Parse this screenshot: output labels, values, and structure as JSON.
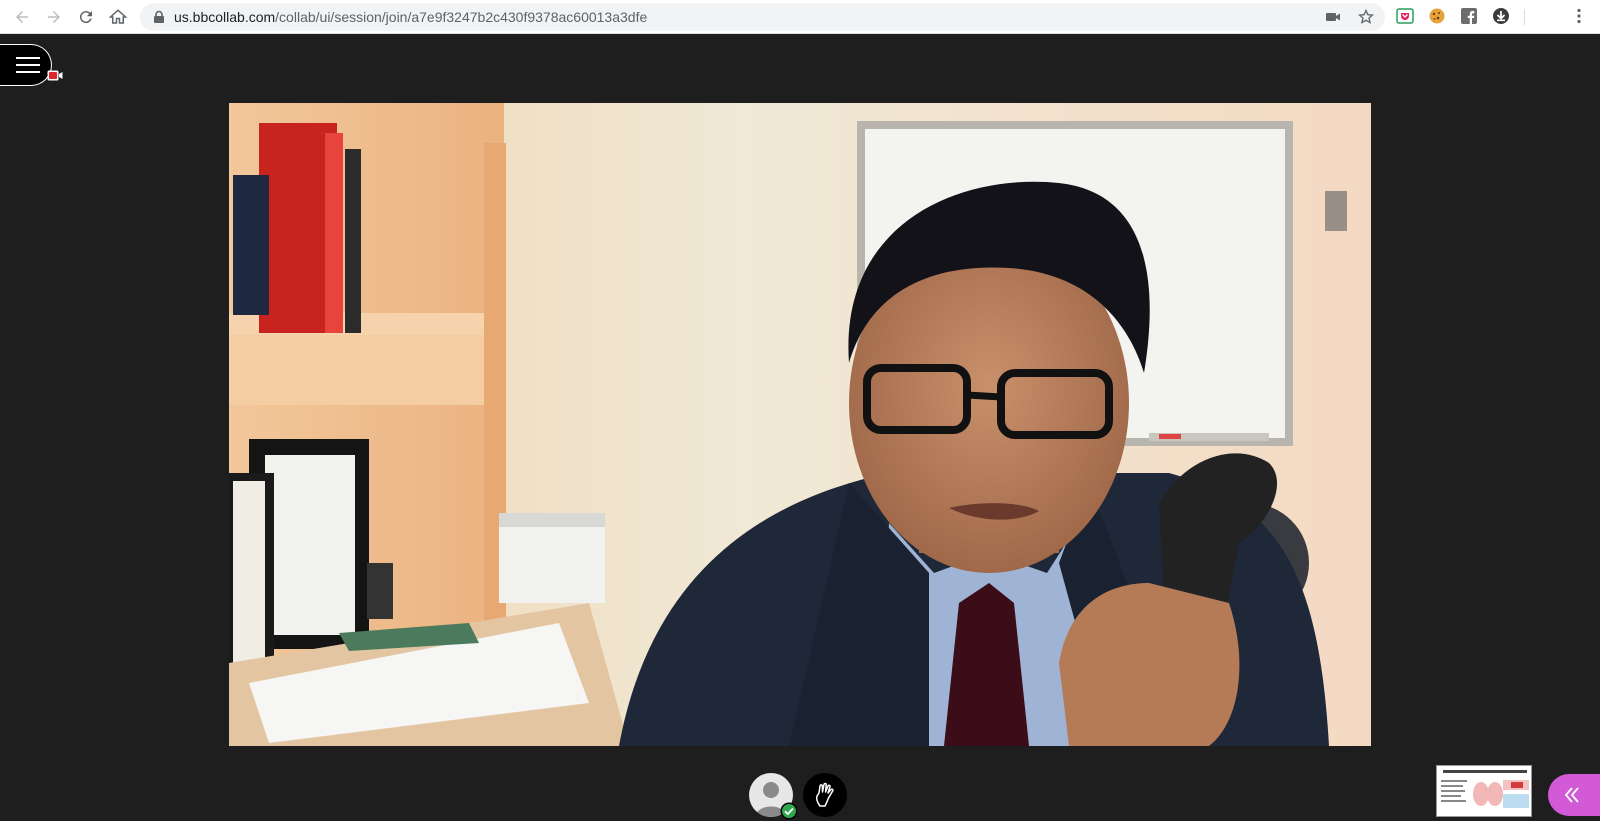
{
  "browser": {
    "url_host": "us.bbcollab.com",
    "url_path": "/collab/ui/session/join/a7e9f3247b2c430f9378ac60013a3dfe",
    "icons": [
      "back-arrow-icon",
      "forward-arrow-icon",
      "reload-icon",
      "home-icon",
      "lock-icon",
      "camera-icon",
      "star-icon",
      "pocket-extension-icon",
      "cookie-extension-icon",
      "facebook-extension-icon",
      "download-icon",
      "more-menu-icon"
    ]
  },
  "session": {
    "menu_icon": "hamburger-menu-icon",
    "recording_icon": "recording-camera-icon",
    "video_description_icon": "presenter-video",
    "controls": {
      "avatar_icon": "user-avatar-icon",
      "status_icon": "check-icon",
      "hand_icon": "raise-hand-icon"
    },
    "panel_toggle_icon": "double-chevron-left-icon"
  },
  "colors": {
    "stage_bg": "#1e1e1e",
    "panel_toggle": "#d25ad6",
    "status_green": "#2fa84f",
    "recording_red": "#e0242b"
  }
}
